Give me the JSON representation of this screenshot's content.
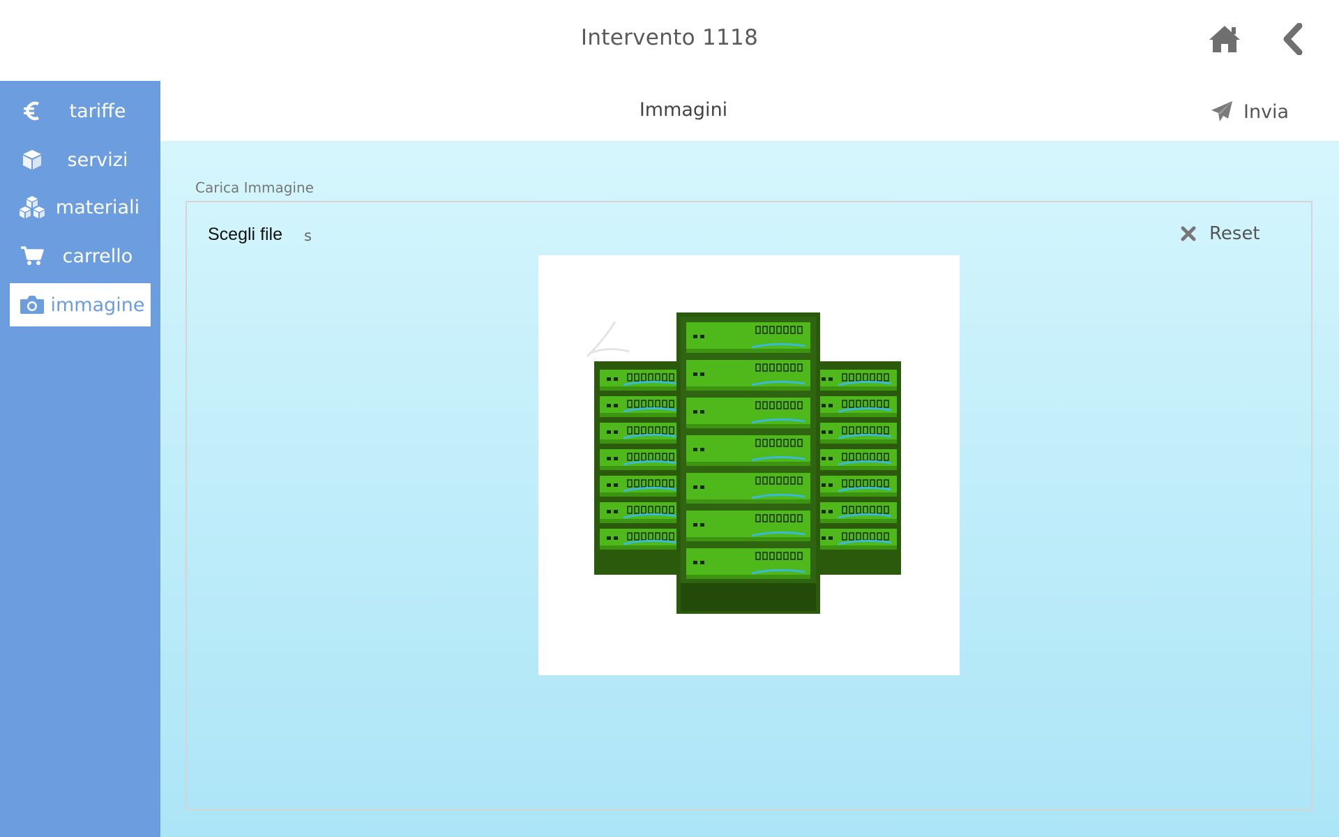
{
  "header": {
    "title": "Intervento 1118",
    "home_icon": "home-icon",
    "back_icon": "chevron-left-icon"
  },
  "sidebar": {
    "items": [
      {
        "label": "tariffe",
        "icon": "euro-icon",
        "active": false
      },
      {
        "label": "servizi",
        "icon": "cube-icon",
        "active": false
      },
      {
        "label": "materiali",
        "icon": "cubes-icon",
        "active": false
      },
      {
        "label": "carrello",
        "icon": "cart-icon",
        "active": false
      },
      {
        "label": "immagine",
        "icon": "camera-icon",
        "active": true
      }
    ]
  },
  "section": {
    "title": "Immagini",
    "send_label": "Invia"
  },
  "upload": {
    "label": "Carica Immagine",
    "file_button": "Scegli file",
    "file_name": "s",
    "reset_label": "Reset"
  },
  "colors": {
    "sidebar": "#6b9ddf",
    "content_top": "#d6f6fd",
    "content_bottom": "#ace5f7",
    "server_dark": "#2b5a0c",
    "server_light": "#4fb81a",
    "server_cable": "#3ab9d8"
  }
}
